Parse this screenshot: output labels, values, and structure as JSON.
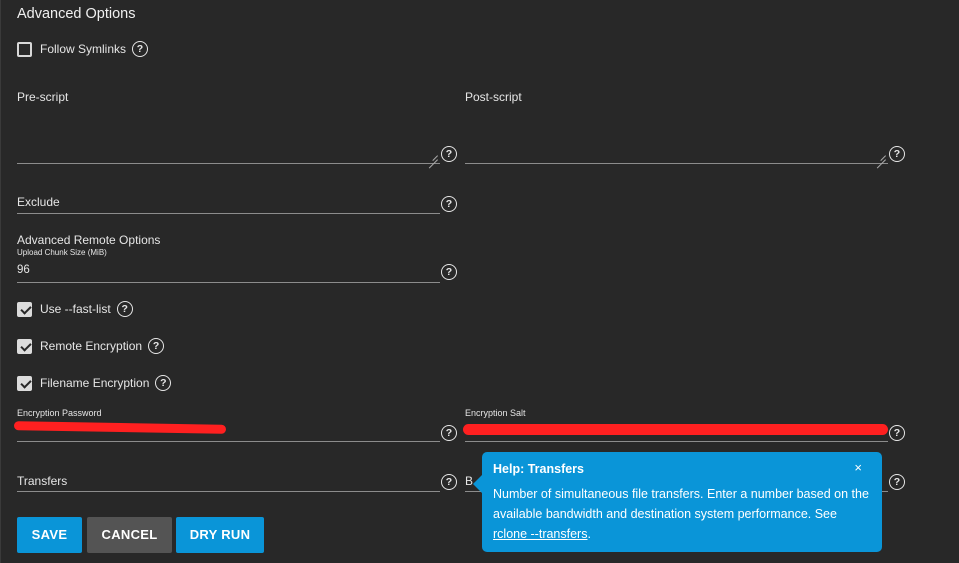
{
  "section": {
    "title": "Advanced Options"
  },
  "follow_symlinks": {
    "label": "Follow Symlinks",
    "checked": false
  },
  "pre_script": {
    "label": "Pre-script",
    "value": ""
  },
  "post_script": {
    "label": "Post-script",
    "value": ""
  },
  "exclude": {
    "label": "Exclude",
    "value": ""
  },
  "remote_options": {
    "title": "Advanced Remote Options",
    "upload_chunk_label": "Upload Chunk Size (MiB)",
    "upload_chunk_value": "96"
  },
  "checkboxes": [
    {
      "label": "Use --fast-list",
      "checked": true
    },
    {
      "label": "Remote Encryption",
      "checked": true
    },
    {
      "label": "Filename Encryption",
      "checked": true
    }
  ],
  "encryption_password": {
    "label": "Encryption Password"
  },
  "encryption_salt": {
    "label": "Encryption Salt"
  },
  "transfers": {
    "label": "Transfers",
    "value": ""
  },
  "partial_label": "B",
  "buttons": {
    "save": "SAVE",
    "cancel": "CANCEL",
    "dry_run": "DRY RUN"
  },
  "help_tooltip": {
    "title": "Help: Transfers",
    "close": "×",
    "body": "Number of simultaneous file transfers. Enter a number based on the available bandwidth and destination system performance. See ",
    "link_text": "rclone --transfers",
    "suffix": "."
  },
  "help_icon_glyph": "?",
  "colors": {
    "background": "#282828",
    "primary": "#0a95d8",
    "secondary": "#545454",
    "redaction": "#ff2020"
  }
}
